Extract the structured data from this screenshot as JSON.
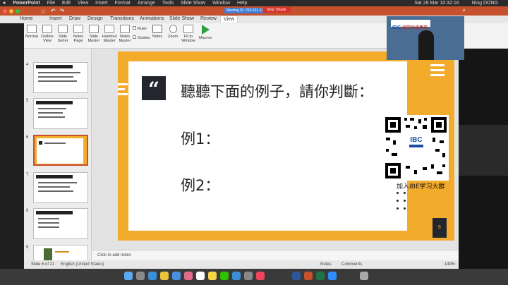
{
  "menubar": {
    "app": "PowerPoint",
    "items": [
      "File",
      "Edit",
      "View",
      "Insert",
      "Format",
      "Arrange",
      "Tools",
      "Slide Show",
      "Window",
      "Help"
    ],
    "meeting_id": "Meeting ID: 292-621-116",
    "stop_share": "Stop Share",
    "zoom_client": "Zoom",
    "datetime": "Sat 28 Mar  10:32:16",
    "user": "Ning DONG"
  },
  "tabs": [
    "Home",
    "Insert",
    "Draw",
    "Design",
    "Transitions",
    "Animations",
    "Slide Show",
    "Review",
    "View"
  ],
  "active_tab": "View",
  "ribbon": {
    "buttons": [
      {
        "label": "Normal"
      },
      {
        "label": "Outline View"
      },
      {
        "label": "Slide Sorter"
      },
      {
        "label": "Notes Page"
      },
      {
        "label": "Slide Master"
      },
      {
        "label": "Handout Master"
      },
      {
        "label": "Notes Master"
      }
    ],
    "checkboxes": [
      "Ruler",
      "Guides"
    ],
    "buttons2": [
      {
        "label": "Notes"
      },
      {
        "label": "Zoom"
      },
      {
        "label": "Fit to Window"
      },
      {
        "label": "Macros"
      }
    ]
  },
  "thumbnails": [
    {
      "num": "4"
    },
    {
      "num": "5"
    },
    {
      "num": "6"
    },
    {
      "num": "7"
    },
    {
      "num": "8"
    },
    {
      "num": "9"
    }
  ],
  "slide": {
    "quote_mark": "“",
    "heading": "聽聽下面的例子，請你判斷：",
    "example1": "例1：",
    "example2": "例2：",
    "page_num": "6",
    "logo_text": "IBC",
    "logo_chinese": "國際聯橋集團",
    "qr_caption": "加入IBE学习大群"
  },
  "notes_placeholder": "Click to add notes",
  "status": {
    "slide_of": "Slide 6 of 21",
    "language": "English (United States)",
    "notes": "Notes",
    "comments": "Comments",
    "zoom": "149%"
  },
  "colors": {
    "slide_accent": "#f3ab2c",
    "title_bar": "#c5512d",
    "quote_box": "#23262f"
  }
}
